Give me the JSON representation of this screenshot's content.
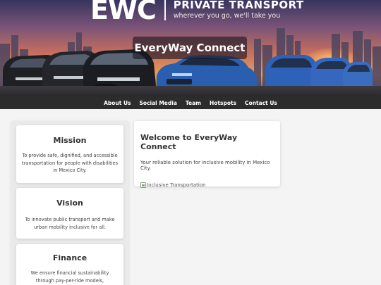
{
  "hero": {
    "logo_mark": "EWC",
    "logo_title": "PRIVATE TRANSPORT",
    "logo_tagline": "wherever you go, we'll take you",
    "title": "EveryWay Connect"
  },
  "nav": {
    "items": [
      {
        "label": "About Us"
      },
      {
        "label": "Social Media"
      },
      {
        "label": "Team"
      },
      {
        "label": "Hotspots"
      },
      {
        "label": "Contact Us"
      }
    ]
  },
  "sidebar": {
    "cards": [
      {
        "title": "Mission",
        "text": "To provide safe, dignified, and accessible transportation for people with disabilities in Mexico City."
      },
      {
        "title": "Vision",
        "text": "To innovate public transport and make urban mobility inclusive for all."
      },
      {
        "title": "Finance",
        "text": "We ensure financial sustainability through pay-per-ride models,"
      }
    ]
  },
  "main": {
    "title": "Welcome to EveryWay Connect",
    "subtitle": "Your reliable solution for inclusive mobility in Mexico City.",
    "image_alt": "Inclusive Transportation"
  },
  "colors": {
    "nav_bg": "#2c2c2c",
    "page_bg": "#f4f4f4",
    "card_bg": "#ffffff"
  }
}
